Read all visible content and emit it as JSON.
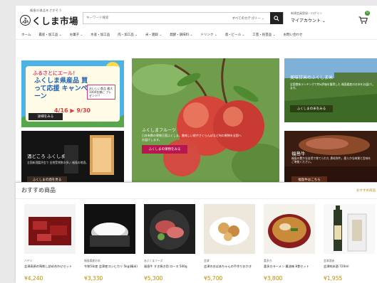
{
  "header": {
    "logo_sub": "福島の逸品をさがそう",
    "logo_mark": "ふ",
    "logo_name": "くしま市場",
    "search_placeholder": "キーワード検索",
    "search_scope": "すべてのカテゴリー ⌄",
    "account_label": "新規会員登録・ログイン",
    "account_name": "マイアカウント ⌄",
    "cart_count": "0"
  },
  "nav": [
    "ホーム",
    "農産・加工品 ⌄",
    "お菓子 ⌄",
    "水産・加工品",
    "肉・加工品 ⌄",
    "米・雑穀 ⌄",
    "発酵・調味料 ⌄",
    "ドリンク ⌄",
    "酒・ビール ⌄",
    "工芸・民芸品 ⌄",
    "お問い合わせ"
  ],
  "hero": {
    "campaign": {
      "top": "ふるさとにエール！",
      "main": "ふくしま県産品 買って応援 キャンペーン",
      "note": "おいしい食品 最大1000名様に プレゼント!!",
      "date": "4/16 ▶ 9/30",
      "button": "詳細をみる"
    },
    "peach": {
      "title": "ふくしまフルーツ",
      "desc": "日本有数の果物王国ふくしま。美味しい桃やさくらんぼなど旬の果物を全国へお届けします。",
      "button": "ふくしまの果物をみる"
    },
    "rice": {
      "title": "美味甘米のふくしま米",
      "desc": "全国食味ランキングで特A評価を獲得した 福島県産のお米をお届けします。",
      "button": "ふくしまの米をみる"
    },
    "sake": {
      "title": "酒どころ ふくしま",
      "desc": "全国新酒鑑評会で 金賞受賞数の多い 福島の地酒。",
      "button": "ふくしまの酒を見る"
    },
    "beef": {
      "title": "福島牛",
      "desc": "福島の豊かな自然で育てられた 黒毛和牛。柔らかな肉質と旨味をご堪能ください。",
      "button": "福島牛はこちら"
    }
  },
  "recommended": {
    "title": "おすすめ商品",
    "more": "おすすめ商品",
    "products": [
      {
        "brand": "ハヤシ",
        "name": "会津高原の馬刺し詰め合わせセット",
        "price": "¥4,240"
      },
      {
        "brand": "福島県産お米",
        "name": "令和5年産 会津産コシヒカリ 5kg(精米)",
        "price": "¥3,330"
      },
      {
        "brand": "あぶくまフーズ",
        "name": "福島牛 すき焼き用 ロース 500g",
        "price": "¥5,300"
      },
      {
        "brand": "会津",
        "name": "会津のおばあちゃんの手作りおかき",
        "price": "¥5,700"
      },
      {
        "brand": "喜多方",
        "name": "喜多方ラーメン 醤油味 8食セット",
        "price": "¥3,800"
      },
      {
        "brand": "会津酒造",
        "name": "会津純米酒 720ml",
        "price": "¥1,955"
      }
    ]
  },
  "colors": {
    "accent_red": "#b8164f",
    "price": "#c98a00",
    "cart_badge": "#3a9a2a"
  }
}
